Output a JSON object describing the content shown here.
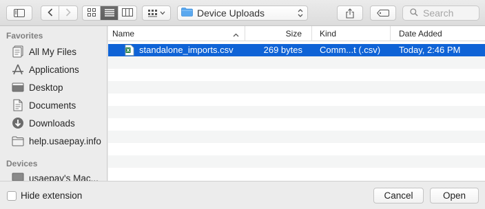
{
  "toolbar": {
    "location": "Device Uploads",
    "search_placeholder": "Search"
  },
  "sidebar": {
    "favorites_header": "Favorites",
    "favorites": [
      {
        "label": "All My Files",
        "icon": "all-files-icon"
      },
      {
        "label": "Applications",
        "icon": "applications-icon"
      },
      {
        "label": "Desktop",
        "icon": "desktop-folder-icon"
      },
      {
        "label": "Documents",
        "icon": "documents-icon"
      },
      {
        "label": "Downloads",
        "icon": "downloads-icon"
      },
      {
        "label": "help.usaepay.info",
        "icon": "folder-icon"
      }
    ],
    "devices_header": "Devices",
    "devices": [
      {
        "label": "usaepay's Mac...",
        "icon": "computer-icon"
      }
    ]
  },
  "file_list": {
    "columns": {
      "name": "Name",
      "size": "Size",
      "kind": "Kind",
      "date_added": "Date Added"
    },
    "sort_column": "name",
    "rows": [
      {
        "name": "standalone_imports.csv",
        "size": "269 bytes",
        "kind": "Comm...t (.csv)",
        "date_added": "Today, 2:46 PM",
        "selected": true,
        "icon": "csv-file-icon"
      }
    ]
  },
  "footer": {
    "hide_extension_label": "Hide extension",
    "hide_extension_checked": false,
    "cancel_label": "Cancel",
    "open_label": "Open"
  },
  "colors": {
    "selection": "#0f63d6",
    "folder_blue": "#5aa8ef"
  }
}
